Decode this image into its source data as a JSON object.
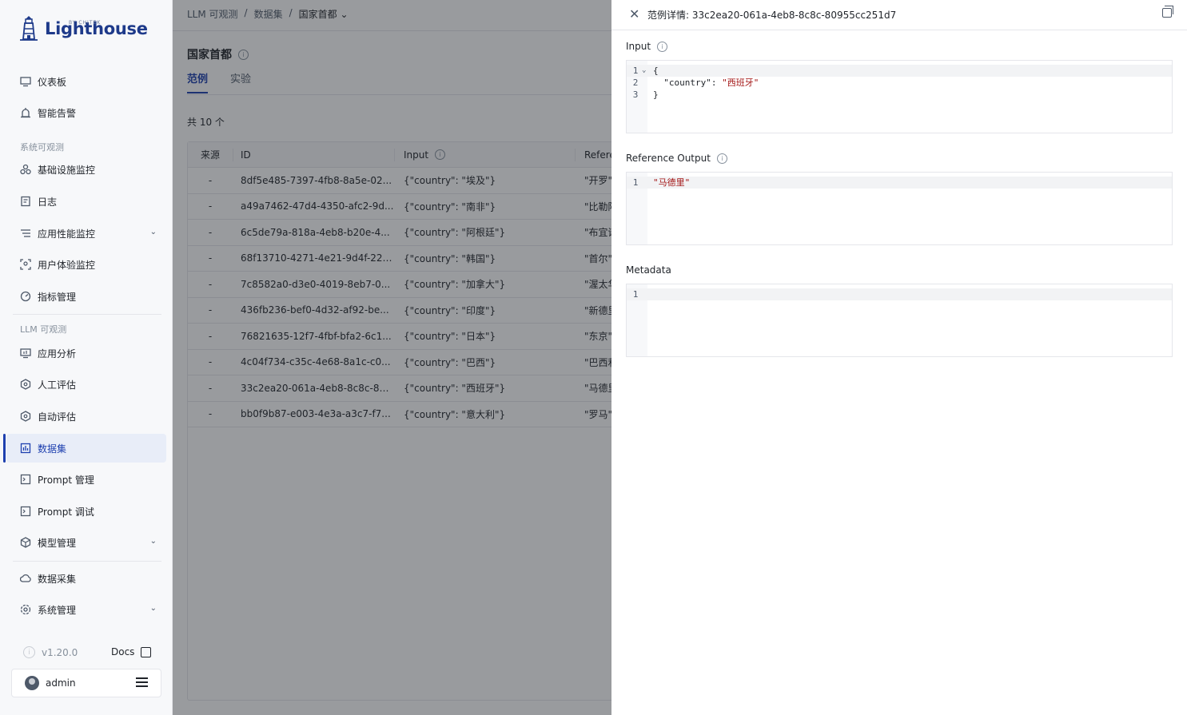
{
  "brand": {
    "name": "Lighthouse",
    "sub": "BY CHITEK"
  },
  "sidebar": {
    "items": [
      {
        "label": "仪表板",
        "icon": "dashboard-icon"
      },
      {
        "label": "智能告警",
        "icon": "alarm-icon"
      },
      {
        "label": "基础设施监控",
        "icon": "infra-icon"
      },
      {
        "label": "日志",
        "icon": "log-icon"
      },
      {
        "label": "应用性能监控",
        "icon": "apm-icon"
      },
      {
        "label": "用户体验监控",
        "icon": "rum-icon"
      },
      {
        "label": "指标管理",
        "icon": "metrics-icon"
      },
      {
        "label": "应用分析",
        "icon": "analysis-icon"
      },
      {
        "label": "人工评估",
        "icon": "human-eval-icon"
      },
      {
        "label": "自动评估",
        "icon": "auto-eval-icon"
      },
      {
        "label": "数据集",
        "icon": "dataset-icon"
      },
      {
        "label": "Prompt 管理",
        "icon": "prompt-icon"
      },
      {
        "label": "Prompt 调试",
        "icon": "prompt-debug-icon"
      },
      {
        "label": "模型管理",
        "icon": "model-icon"
      },
      {
        "label": "数据采集",
        "icon": "collect-icon"
      },
      {
        "label": "系统管理",
        "icon": "system-icon"
      }
    ],
    "groups": {
      "system": "系统可观测",
      "llm": "LLM 可观测"
    },
    "version": "v1.20.0",
    "docs": "Docs",
    "user": "admin"
  },
  "breadcrumb": {
    "a": "LLM 可观测",
    "sep": "/",
    "b": "数据集",
    "c": "国家首都"
  },
  "page": {
    "title": "国家首都",
    "tabs": [
      "范例",
      "实验"
    ],
    "total": "共 10 个"
  },
  "table": {
    "headers": [
      "来源",
      "ID",
      "Input",
      "Refere"
    ],
    "rows": [
      {
        "src": "-",
        "id": "8df5e485-7397-4fb8-8a5e-02...",
        "input": "{\"country\": \"埃及\"}",
        "ref": "\"开罗\""
      },
      {
        "src": "-",
        "id": "a49a7462-47d4-4350-afc2-9d...",
        "input": "{\"country\": \"南非\"}",
        "ref": "\"比勒陀"
      },
      {
        "src": "-",
        "id": "6c5de79a-818a-4eb8-b20e-4...",
        "input": "{\"country\": \"阿根廷\"}",
        "ref": "\"布宜诺"
      },
      {
        "src": "-",
        "id": "68f13710-4271-4e21-9d4f-22f...",
        "input": "{\"country\": \"韩国\"}",
        "ref": "\"首尔\""
      },
      {
        "src": "-",
        "id": "7c8582a0-d3e0-4019-8eb7-0...",
        "input": "{\"country\": \"加拿大\"}",
        "ref": "\"渥太华"
      },
      {
        "src": "-",
        "id": "436fb236-bef0-4d32-af92-be...",
        "input": "{\"country\": \"印度\"}",
        "ref": "\"新德里"
      },
      {
        "src": "-",
        "id": "76821635-12f7-4fbf-bfa2-6c1...",
        "input": "{\"country\": \"日本\"}",
        "ref": "\"东京\""
      },
      {
        "src": "-",
        "id": "4c04f734-c35c-4e68-8a1c-c0...",
        "input": "{\"country\": \"巴西\"}",
        "ref": "\"巴西利"
      },
      {
        "src": "-",
        "id": "33c2ea20-061a-4eb8-8c8c-80...",
        "input": "{\"country\": \"西班牙\"}",
        "ref": "\"马德里"
      },
      {
        "src": "-",
        "id": "bb0f9b87-e003-4e3a-a3c7-f7...",
        "input": "{\"country\": \"意大利\"}",
        "ref": "\"罗马\""
      }
    ]
  },
  "drawer": {
    "title": "范例详情: 33c2ea20-061a-4eb8-8c8c-80955cc251d7",
    "input_label": "Input",
    "input_lines": [
      {
        "n": "1",
        "code": "{"
      },
      {
        "n": "2",
        "key": "  \"country\": ",
        "val": "\"西班牙\""
      },
      {
        "n": "3",
        "code": "}"
      }
    ],
    "output_label": "Reference Output",
    "output_lines": [
      {
        "n": "1",
        "val": "\"马德里\""
      }
    ],
    "metadata_label": "Metadata",
    "metadata_lines": [
      {
        "n": "1",
        "code": ""
      }
    ]
  }
}
